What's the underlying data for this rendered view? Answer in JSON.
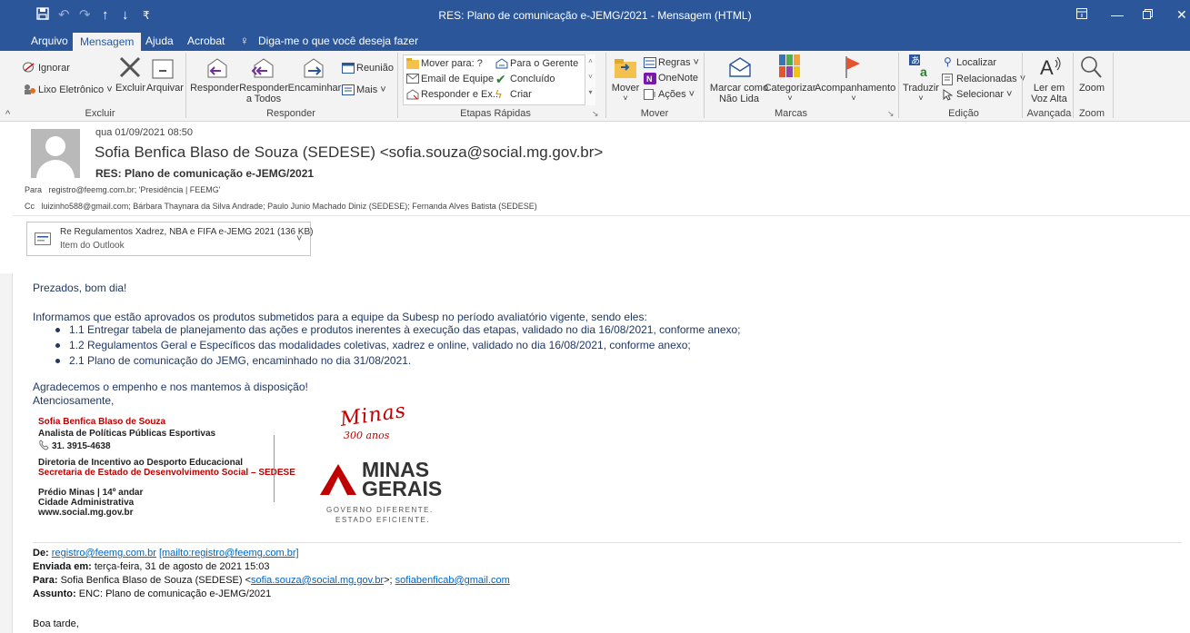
{
  "window": {
    "title": "RES: Plano de comunicação e-JEMG/2021  -  Mensagem (HTML)",
    "quick_access": [
      "save-icon",
      "undo-icon",
      "redo-icon",
      "up-arrow-icon",
      "down-arrow-icon",
      "customize-icon"
    ],
    "accent": "#2b579a"
  },
  "tabs": {
    "items": [
      {
        "label": "Arquivo"
      },
      {
        "label": "Mensagem"
      },
      {
        "label": "Ajuda"
      },
      {
        "label": "Acrobat"
      }
    ],
    "tell_me": "Diga-me o que você deseja fazer"
  },
  "ribbon": {
    "excluir": {
      "ignorar": "Ignorar",
      "lixo": "Lixo Eletrônico",
      "excluir": "Excluir",
      "arquivar": "Arquivar",
      "group": "Excluir"
    },
    "responder": {
      "responder": "Responder",
      "responder_todos_1": "Responder",
      "responder_todos_2": "a Todos",
      "encaminhar": "Encaminhar",
      "reuniao": "Reunião",
      "mais": "Mais",
      "group": "Responder"
    },
    "etapas": {
      "mover_para": "Mover para: ?",
      "email_equipe": "Email de Equipe",
      "responder_ex": "Responder e Ex...",
      "para_gerente": "Para o Gerente",
      "concluido": "Concluído",
      "criar": "Criar",
      "group": "Etapas Rápidas"
    },
    "mover": {
      "mover": "Mover",
      "regras": "Regras",
      "onenote": "OneNote",
      "acoes": "Ações",
      "group": "Mover"
    },
    "marcas": {
      "marcar_1": "Marcar como",
      "marcar_2": "Não Lida",
      "categorizar": "Categorizar",
      "acompanhamento": "Acompanhamento",
      "group": "Marcas"
    },
    "edicao": {
      "traduzir": "Traduzir",
      "localizar": "Localizar",
      "relacionadas": "Relacionadas",
      "selecionar": "Selecionar",
      "group": "Edição"
    },
    "avancada": {
      "ler_1": "Ler em",
      "ler_2": "Voz Alta",
      "group": "Avançada"
    },
    "zoom": {
      "zoom": "Zoom",
      "group": "Zoom"
    }
  },
  "message": {
    "date": "qua 01/09/2021 08:50",
    "from": "Sofia Benfica Blaso de Souza (SEDESE) <sofia.souza@social.mg.gov.br>",
    "subject": "RES: Plano de comunicação e-JEMG/2021",
    "to_label": "Para",
    "to": "registro@feemg.com.br; 'Presidência | FEEMG'",
    "cc_label": "Cc",
    "cc": "luizinho588@gmail.com; Bárbara Thaynara da Silva Andrade; Paulo Junio Machado Diniz (SEDESE); Fernanda Alves Batista (SEDESE)",
    "attachment": {
      "name": "Re Regulamentos Xadrez, NBA e FIFA e-JEMG 2021 (136 KB)",
      "type": "Item do Outlook"
    }
  },
  "body": {
    "greeting": "Prezados, bom dia!",
    "intro": "Informamos que estão aprovados os produtos submetidos para a equipe da Subesp no período avaliatório vigente, sendo eles:",
    "items": [
      "1.1 Entregar tabela de planejamento das ações e produtos inerentes à execução das etapas, validado no dia 16/08/2021, conforme anexo;",
      "1.2 Regulamentos Geral e Específicos das modalidades coletivas, xadrez e online, validado no dia 16/08/2021, conforme anexo;",
      "2.1 Plano de comunicação do JEMG, encaminhado no dia 31/08/2021."
    ],
    "thanks": "Agradecemos o empenho e nos mantemos à disposição!",
    "regards": "Atenciosamente,",
    "text_color": "#1f3864"
  },
  "signature": {
    "name": "Sofia Benfica Blaso de Souza",
    "role": "Analista de Políticas Públicas Esportivas",
    "phone": "31. 3915-4638",
    "dept": "Diretoria de Incentivo ao Desporto Educacional",
    "secretariat": "Secretaria de Estado de Desenvolvimento Social – SEDESE",
    "address_1": "Prédio Minas | 14º andar",
    "address_2": "Cidade Administrativa",
    "site": "www.social.mg.gov.br",
    "logo_script": "Minas",
    "logo_years": "300 anos",
    "logo_minas": "MINAS",
    "logo_gerais": "GERAIS",
    "logo_tag_1": "GOVERNO DIFERENTE.",
    "logo_tag_2": "ESTADO EFICIENTE.",
    "brand_red": "#c00000"
  },
  "forwarded": {
    "de_label": "De:",
    "de_email": "registro@feemg.com.br",
    "de_mailto": "[mailto:registro@feemg.com.br]",
    "enviada_label": "Enviada em:",
    "enviada": "terça-feira, 31 de agosto de 2021 15:03",
    "para_label": "Para:",
    "para_name": "Sofia Benfica Blaso de Souza (SEDESE) <",
    "para_email1": "sofia.souza@social.mg.gov.br",
    "para_sep": ">; ",
    "para_email2": "sofiabenficab@gmail.com",
    "assunto_label": "Assunto:",
    "assunto": "ENC: Plano de comunicação e-JEMG/2021",
    "closing": "Boa tarde,"
  }
}
